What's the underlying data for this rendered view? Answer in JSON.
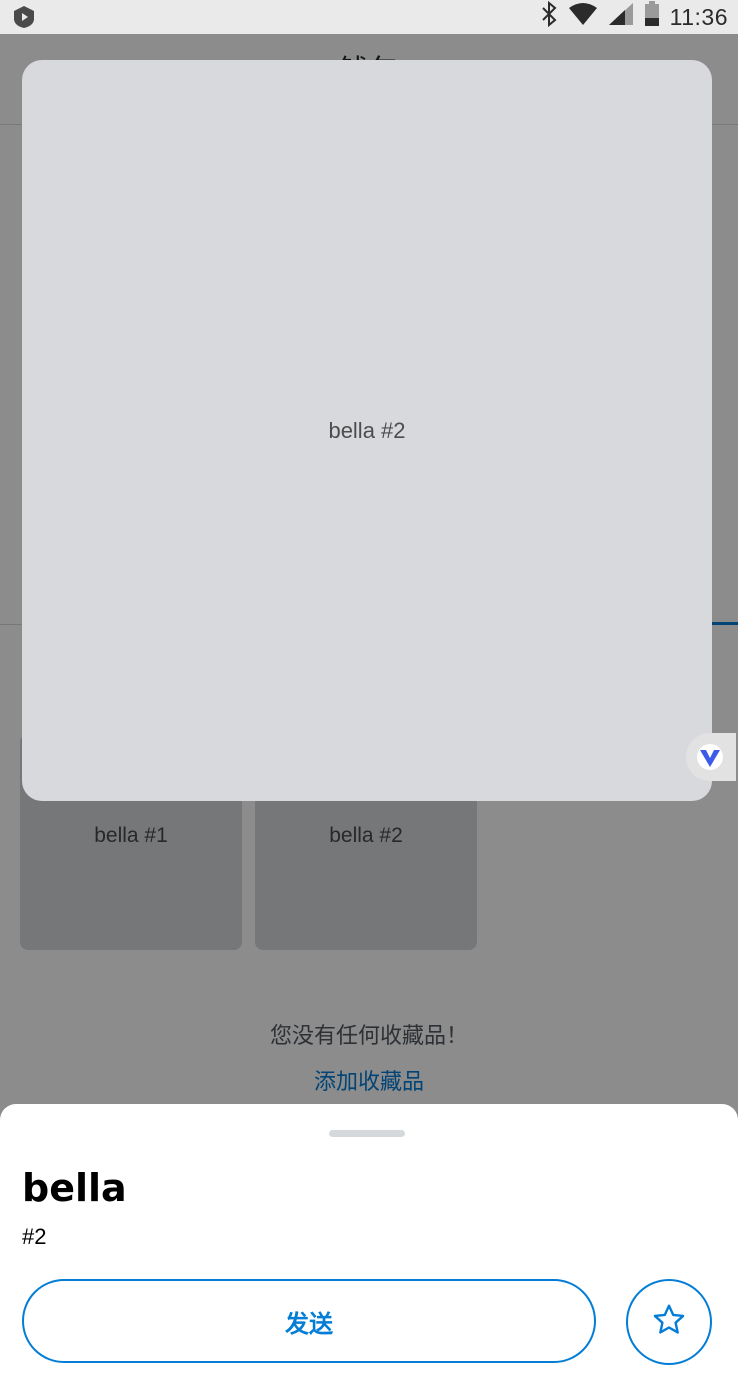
{
  "status_bar": {
    "time": "11:36"
  },
  "header": {
    "title": "钱包"
  },
  "collectibles": [
    {
      "label": "bella #1"
    },
    {
      "label": "bella #2"
    }
  ],
  "empty_state": {
    "message": "您没有任何收藏品！",
    "add_link": "添加收藏品"
  },
  "preview": {
    "label": "bella #2"
  },
  "sheet": {
    "title": "bella",
    "token_id": "#2",
    "send_label": "发送"
  },
  "colors": {
    "accent": "#037dd6",
    "badge": "#3c5bea"
  }
}
